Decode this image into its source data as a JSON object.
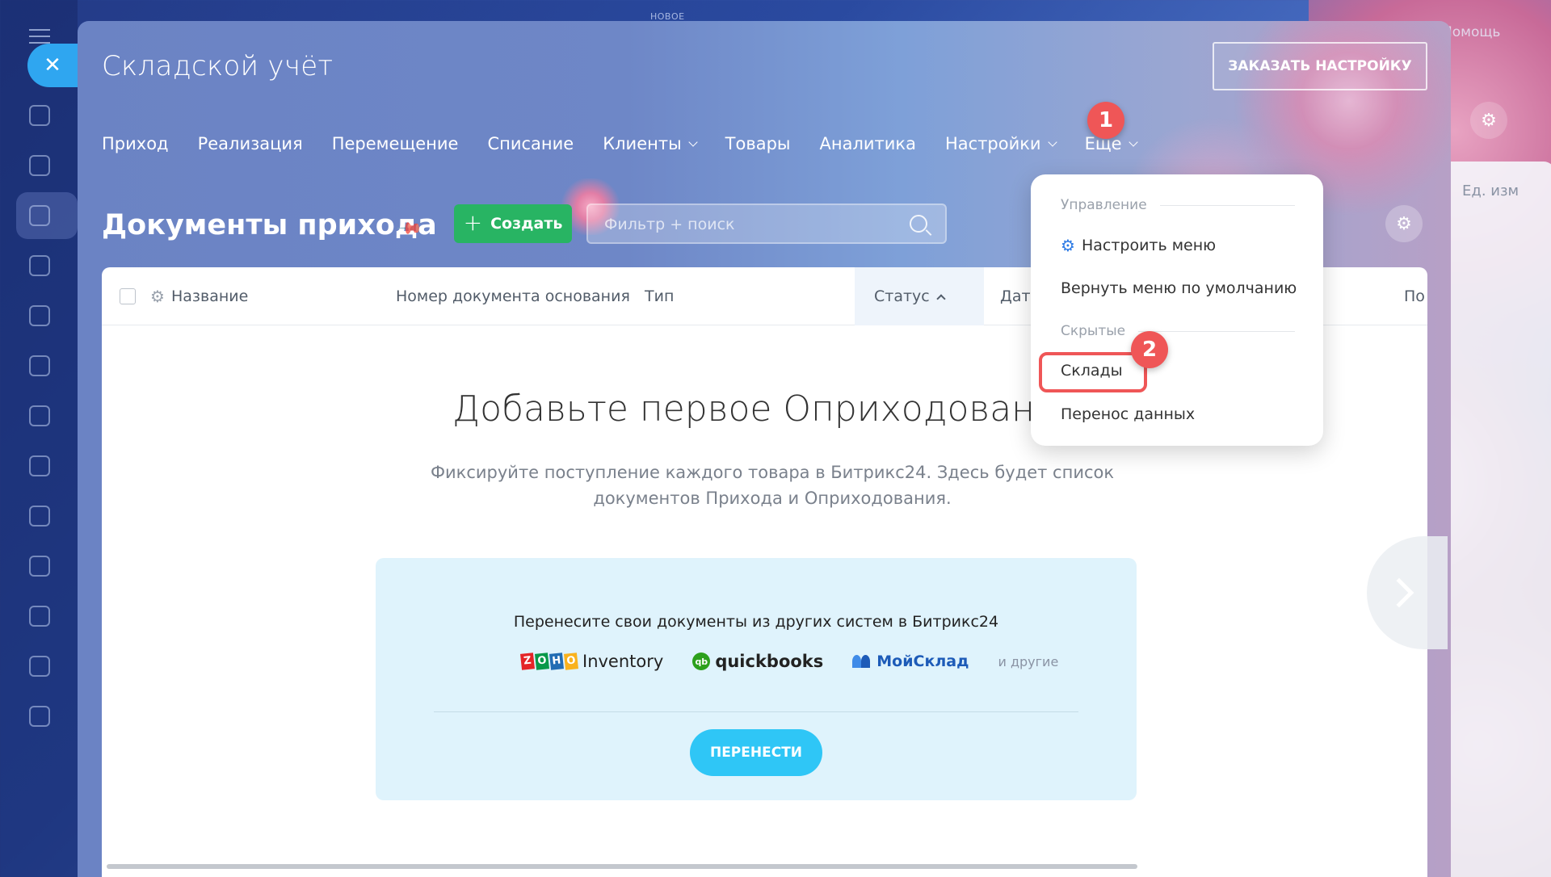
{
  "background": {
    "help_label": "Помощь",
    "novoe_label": "НОВОЕ",
    "right_panel_label": "Ед. изм"
  },
  "header": {
    "title": "Складской учёт",
    "order_setup_label": "ЗАКАЗАТЬ НАСТРОЙКУ"
  },
  "nav": {
    "items": [
      {
        "label": "Приход"
      },
      {
        "label": "Реализация"
      },
      {
        "label": "Перемещение"
      },
      {
        "label": "Списание"
      },
      {
        "label": "Клиенты"
      },
      {
        "label": "Товары"
      },
      {
        "label": "Аналитика"
      },
      {
        "label": "Настройки"
      },
      {
        "label": "Еще"
      }
    ]
  },
  "badges": {
    "one": "1",
    "two": "2"
  },
  "toolbar": {
    "title": "Документы прихода",
    "create_label": "Создать",
    "search_placeholder": "Фильтр + поиск"
  },
  "table": {
    "columns": [
      "Название",
      "Номер документа основания",
      "Тип",
      "Статус",
      "Дат",
      "По"
    ]
  },
  "empty_state": {
    "title": "Добавьте первое Оприходование",
    "description": "Фиксируйте поступление каждого товара в Битрикс24. Здесь будет список документов Прихода и Оприходования."
  },
  "migration": {
    "title": "Перенесите свои документы из других систем в Битрикс24",
    "logo_zoho_letters": [
      "Z",
      "O",
      "H",
      "O"
    ],
    "logo_zoho_text": "Inventory",
    "logo_qb_mark": "qb",
    "logo_qb_text": "quickbooks",
    "logo_ms_text": "МойСклад",
    "others": "и другие",
    "button_label": "ПЕРЕНЕСТИ"
  },
  "dropdown": {
    "section_manage": "Управление",
    "configure_menu": "Настроить меню",
    "reset_menu": "Вернуть меню по умолчанию",
    "section_hidden": "Скрытые",
    "warehouses": "Склады",
    "data_transfer": "Перенос данных"
  },
  "colors": {
    "accent_red": "#ef5657",
    "create_green": "#28b463",
    "migrate_blue": "#2fc6f6"
  }
}
